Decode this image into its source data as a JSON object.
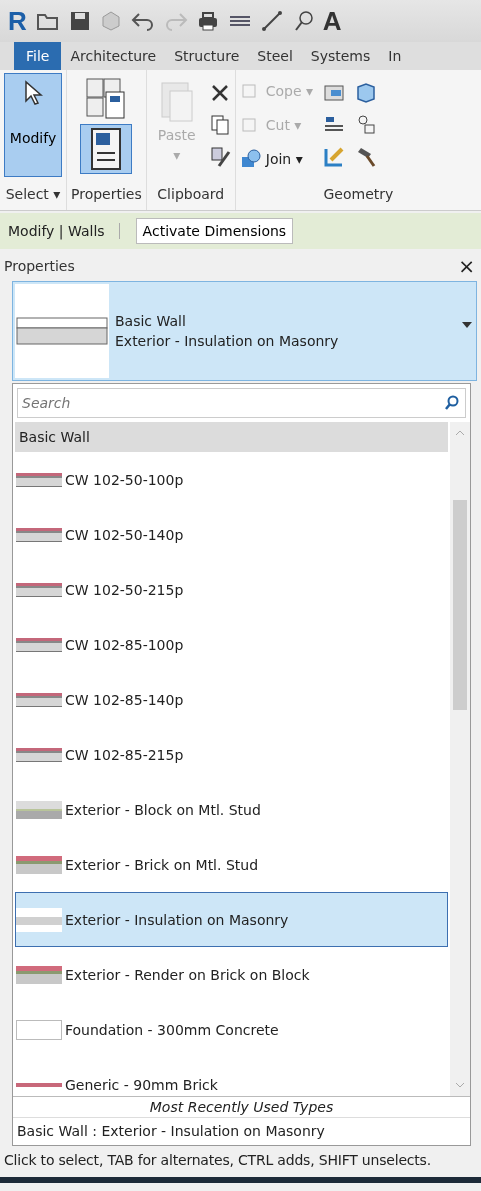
{
  "quick_access": {
    "logo": "R",
    "text_tool": "A"
  },
  "tabs": [
    {
      "label": "File",
      "selected": true
    },
    {
      "label": "Architecture",
      "selected": false
    },
    {
      "label": "Structure",
      "selected": false
    },
    {
      "label": "Steel",
      "selected": false
    },
    {
      "label": "Systems",
      "selected": false
    },
    {
      "label": "In",
      "selected": false
    }
  ],
  "ribbon": {
    "modify": {
      "label": "Modify",
      "selected": true
    },
    "properties_toggle": {
      "selected": true
    },
    "paste": {
      "label": "Paste",
      "arrow": "▾",
      "disabled": true
    },
    "geometry_tools": [
      {
        "label": "Cope",
        "arrow": "▾",
        "disabled": true
      },
      {
        "label": "Cut",
        "arrow": "▾",
        "disabled": true
      },
      {
        "label": "Join",
        "arrow": "▾",
        "disabled": false
      }
    ],
    "panel_labels": [
      "Select ▾",
      "Properties",
      "Clipboard",
      "Geometry"
    ]
  },
  "context_bar": {
    "title": "Modify | Walls",
    "button": "Activate Dimensions"
  },
  "properties": {
    "title": "Properties",
    "close": "×",
    "type_selector": {
      "family": "Basic Wall",
      "type": "Exterior - Insulation on Masonry"
    },
    "search": {
      "placeholder": "Search"
    },
    "group": "Basic Wall",
    "types": [
      {
        "label": "CW 102-50-100p",
        "kind": "cavity",
        "selected": false
      },
      {
        "label": "CW 102-50-140p",
        "kind": "cavity",
        "selected": false
      },
      {
        "label": "CW 102-50-215p",
        "kind": "cavity",
        "selected": false
      },
      {
        "label": "CW 102-85-100p",
        "kind": "cavity",
        "selected": false
      },
      {
        "label": "CW 102-85-140p",
        "kind": "cavity",
        "selected": false
      },
      {
        "label": "CW 102-85-215p",
        "kind": "cavity",
        "selected": false
      },
      {
        "label": "Exterior - Block on Mtl. Stud",
        "kind": "block",
        "selected": false
      },
      {
        "label": "Exterior - Brick on Mtl. Stud",
        "kind": "brick",
        "selected": false
      },
      {
        "label": "Exterior - Insulation on Masonry",
        "kind": "insulation",
        "selected": true
      },
      {
        "label": "Exterior - Render on Brick on Block",
        "kind": "brick",
        "selected": false
      },
      {
        "label": "Foundation - 300mm Concrete",
        "kind": "plain",
        "selected": false
      },
      {
        "label": "Generic - 90mm Brick",
        "kind": "generic",
        "selected": false
      }
    ],
    "recent_heading": "Most Recently Used Types",
    "recent": [
      "Basic Wall : Exterior - Insulation on Masonry"
    ]
  },
  "status_bar": "Click to select, TAB for alternates, CTRL adds, SHIFT unselects."
}
